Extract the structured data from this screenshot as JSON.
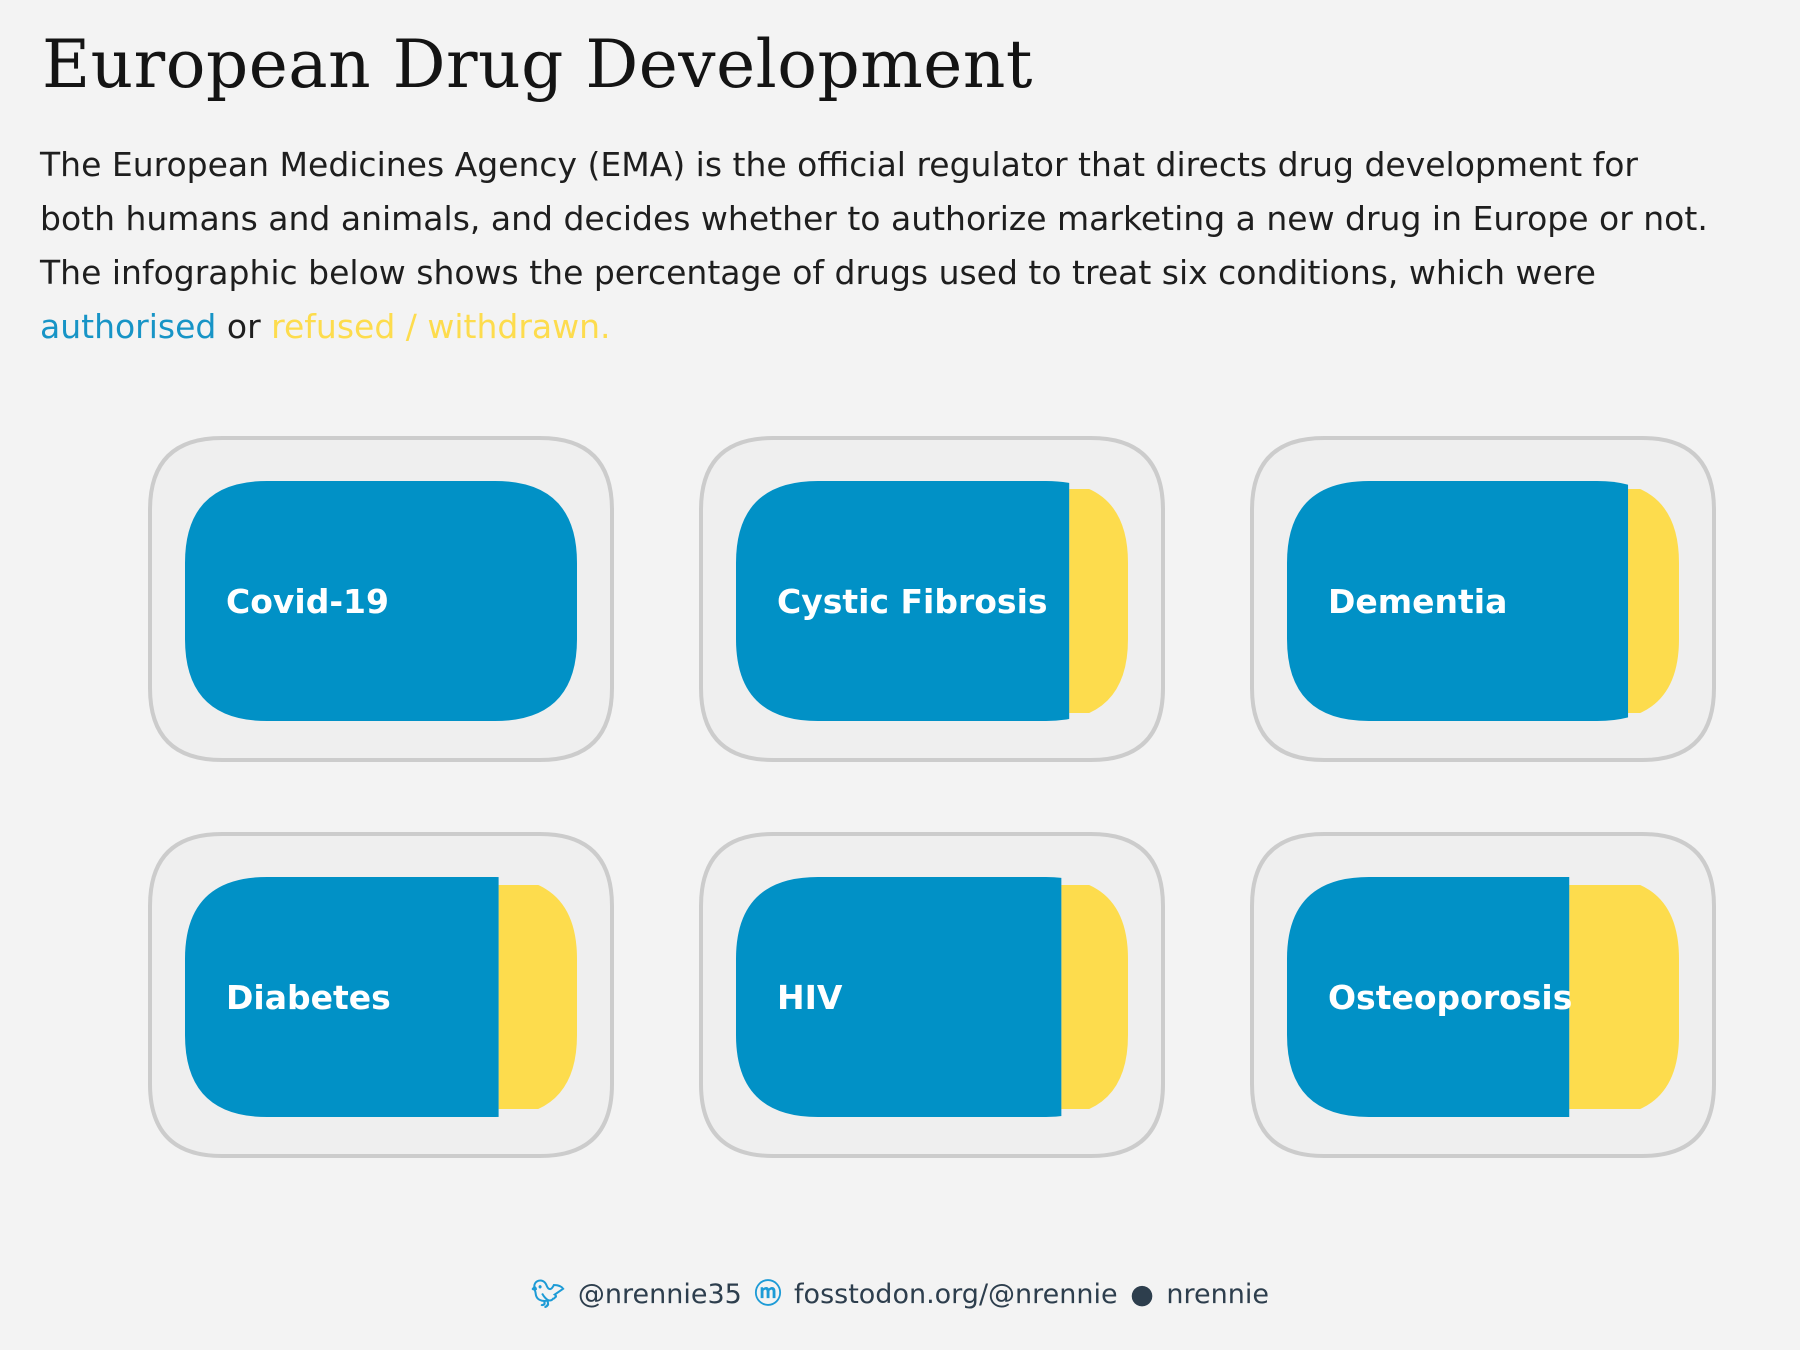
{
  "header": {
    "title": "European Drug Development",
    "subtitle_text": "The European Medicines Agency (EMA) is the official regulator that directs drug development for both humans and animals, and decides whether to authorize marketing a new drug in Europe or not. The infographic below shows the percentage of drugs used to treat six conditions, which were",
    "authorised_label": "authorised",
    "or_label": "or",
    "refused_label": "refused / withdrawn."
  },
  "colors": {
    "background": "#f3f3f3",
    "pill_case": "#efefef",
    "pill_case_border": "#cccccc",
    "authorised": "#0191c6",
    "refused": "#fddc4d",
    "label": "#ffffff"
  },
  "chart_data": {
    "type": "bar",
    "series": [
      {
        "name": "authorised",
        "color": "#0191c6"
      },
      {
        "name": "refused / withdrawn",
        "color": "#fddc4d"
      }
    ],
    "categories": [
      "Covid-19",
      "Cystic Fibrosis",
      "Dementia",
      "Diabetes",
      "HIV",
      "Osteoporosis"
    ],
    "authorised_pct": [
      100,
      85,
      87,
      80,
      83,
      72
    ],
    "refused_pct": [
      0,
      15,
      13,
      20,
      17,
      28
    ]
  },
  "footer": {
    "twitter_icon": "twitter-icon",
    "twitter": "@nrennie35",
    "mastodon_icon": "mastodon-icon",
    "mastodon": "fosstodon.org/@nrennie",
    "github_icon": "github-icon",
    "github": "nrennie"
  }
}
